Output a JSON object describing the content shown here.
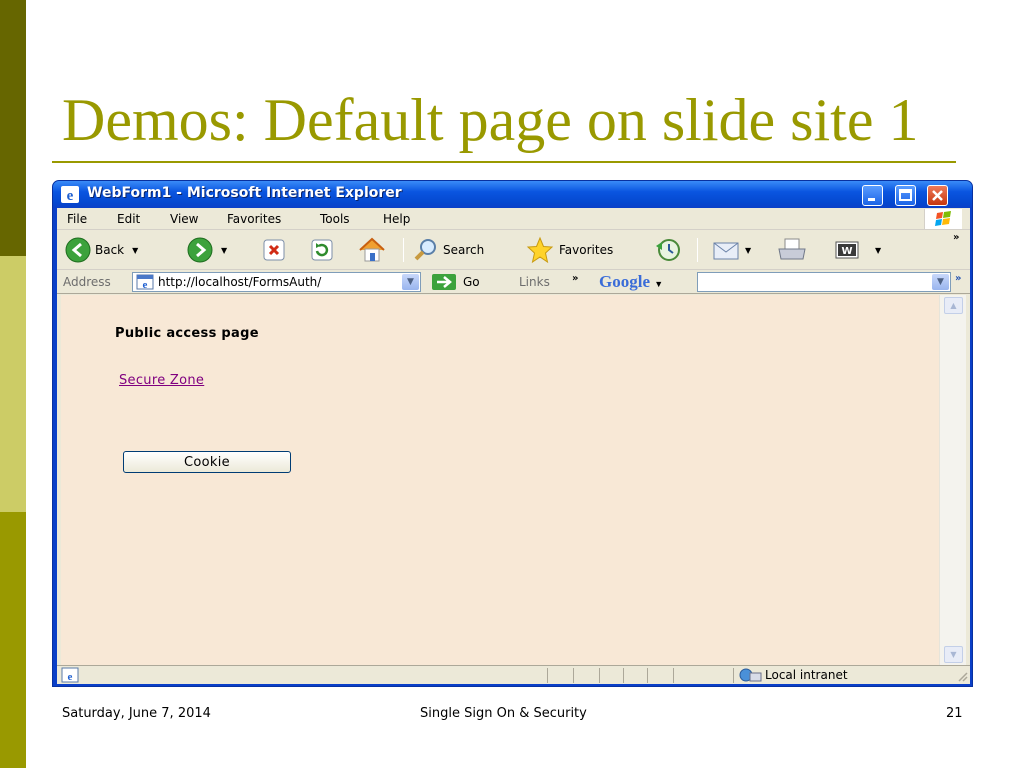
{
  "slide": {
    "title": "Demos: Default page on slide site 1",
    "footer": {
      "date": "Saturday, June 7, 2014",
      "center": "Single Sign On & Security",
      "page_number": "21"
    },
    "colors": {
      "accent": "#999900",
      "dark_bar": "#666600",
      "light_bar": "#cccc66"
    }
  },
  "window": {
    "title": "WebForm1 - Microsoft Internet Explorer",
    "menu": [
      "File",
      "Edit",
      "View",
      "Favorites",
      "Tools",
      "Help"
    ],
    "toolbar": {
      "back_label": "Back",
      "search_label": "Search",
      "favorites_label": "Favorites"
    },
    "address": {
      "label": "Address",
      "url": "http://localhost/FormsAuth/",
      "go_label": "Go",
      "links_label": "Links"
    },
    "google_label": "Google",
    "status": {
      "zone": "Local intranet"
    }
  },
  "page": {
    "heading": "Public access page",
    "link": "Secure Zone",
    "button": "Cookie",
    "background": "#f8e8d6"
  }
}
